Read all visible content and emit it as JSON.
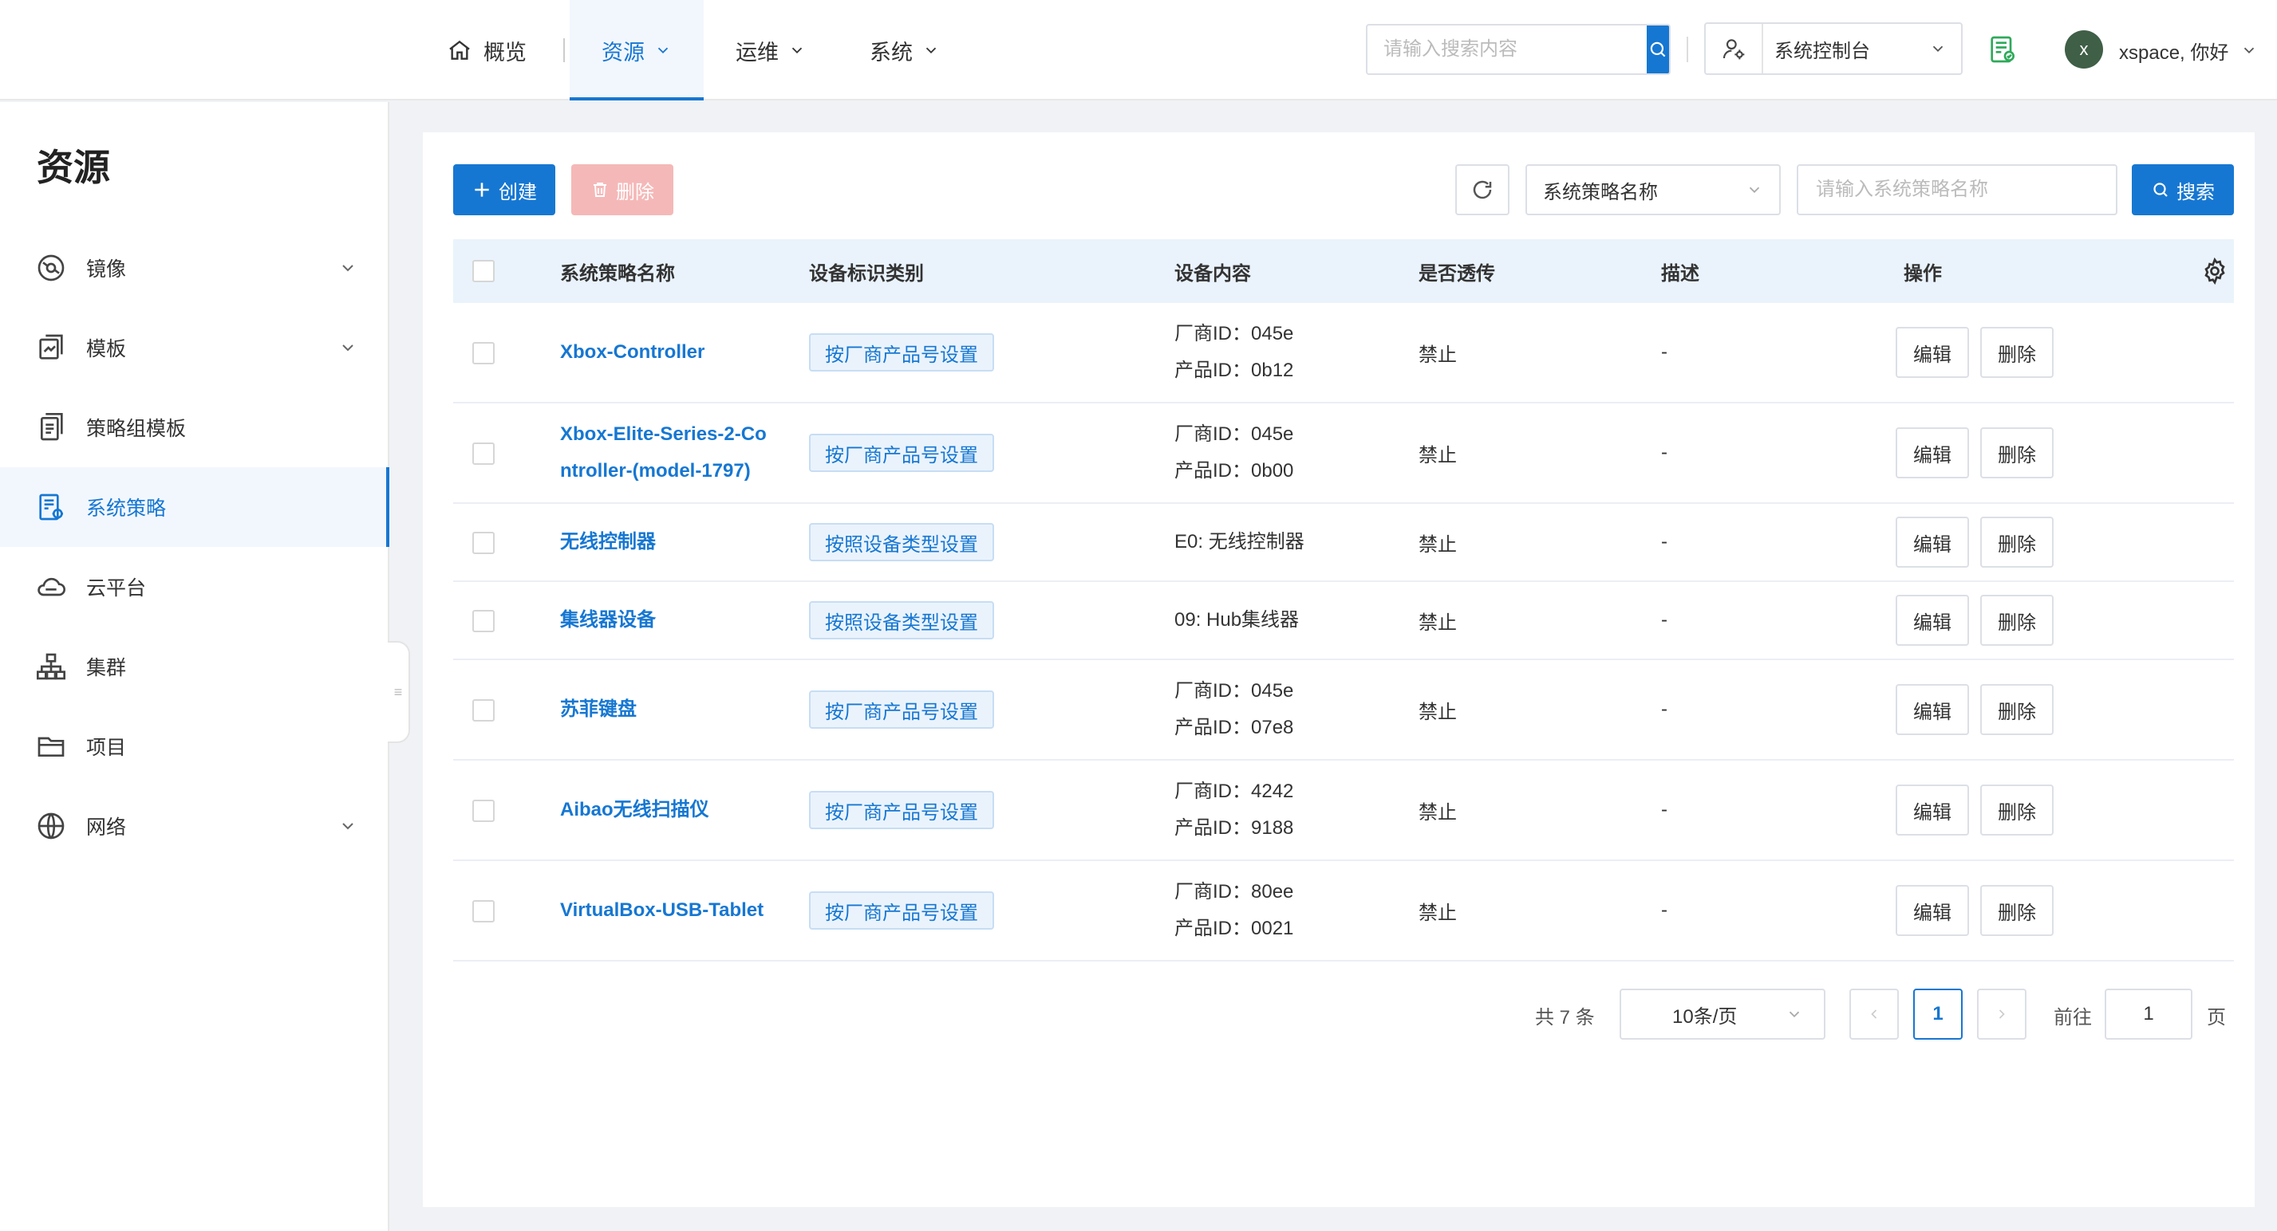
{
  "topbar": {
    "nav": {
      "overview": "概览",
      "resources": "资源",
      "ops": "运维",
      "system": "系统"
    },
    "search_placeholder": "请输入搜索内容",
    "console_label": "系统控制台",
    "avatar_letter": "x",
    "username": "xspace, 你好"
  },
  "sidebar": {
    "title": "资源",
    "items": [
      {
        "label": "镜像",
        "icon": "image-disc-icon",
        "expandable": true
      },
      {
        "label": "模板",
        "icon": "template-icon",
        "expandable": true
      },
      {
        "label": "策略组模板",
        "icon": "policy-group-template-icon",
        "expandable": false
      },
      {
        "label": "系统策略",
        "icon": "system-policy-icon",
        "expandable": false,
        "active": true
      },
      {
        "label": "云平台",
        "icon": "cloud-icon",
        "expandable": false
      },
      {
        "label": "集群",
        "icon": "cluster-icon",
        "expandable": false
      },
      {
        "label": "项目",
        "icon": "folder-icon",
        "expandable": false
      },
      {
        "label": "网络",
        "icon": "globe-icon",
        "expandable": true
      }
    ]
  },
  "toolbar": {
    "create_label": "创建",
    "delete_label": "删除",
    "field_select_value": "系统策略名称",
    "search_placeholder": "请输入系统策略名称",
    "search_label": "搜索"
  },
  "table": {
    "columns": {
      "name": "系统策略名称",
      "id_type": "设备标识类别",
      "content": "设备内容",
      "passthrough": "是否透传",
      "desc": "描述",
      "ops": "操作"
    },
    "rows": [
      {
        "name": "Xbox-Controller",
        "id_type": "按厂商产品号设置",
        "content": [
          "厂商ID：045e",
          "产品ID：0b12"
        ],
        "passthrough": "禁止",
        "desc": "-"
      },
      {
        "name": "Xbox-Elite-Series-2-Controller-(model-1797)",
        "id_type": "按厂商产品号设置",
        "content": [
          "厂商ID：045e",
          "产品ID：0b00"
        ],
        "passthrough": "禁止",
        "desc": "-"
      },
      {
        "name": "无线控制器",
        "id_type": "按照设备类型设置",
        "content": [
          "E0: 无线控制器"
        ],
        "passthrough": "禁止",
        "desc": "-"
      },
      {
        "name": "集线器设备",
        "id_type": "按照设备类型设置",
        "content": [
          "09: Hub集线器"
        ],
        "passthrough": "禁止",
        "desc": "-"
      },
      {
        "name": "苏菲键盘",
        "id_type": "按厂商产品号设置",
        "content": [
          "厂商ID：045e",
          "产品ID：07e8"
        ],
        "passthrough": "禁止",
        "desc": "-"
      },
      {
        "name": "Aibao无线扫描仪",
        "id_type": "按厂商产品号设置",
        "content": [
          "厂商ID：4242",
          "产品ID：9188"
        ],
        "passthrough": "禁止",
        "desc": "-"
      },
      {
        "name": "VirtualBox-USB-Tablet",
        "id_type": "按厂商产品号设置",
        "content": [
          "厂商ID：80ee",
          "产品ID：0021"
        ],
        "passthrough": "禁止",
        "desc": "-"
      }
    ],
    "edit_label": "编辑",
    "row_delete_label": "删除"
  },
  "pagination": {
    "total": "共 7 条",
    "page_size": "10条/页",
    "current_page": "1",
    "goto_label": "前往",
    "goto_value": "1",
    "page_unit": "页"
  },
  "colors": {
    "primary": "#1677d2",
    "danger_disabled": "#f5b8b8",
    "header_bg": "#eaf3fc",
    "avatar": "#3f5f47"
  }
}
